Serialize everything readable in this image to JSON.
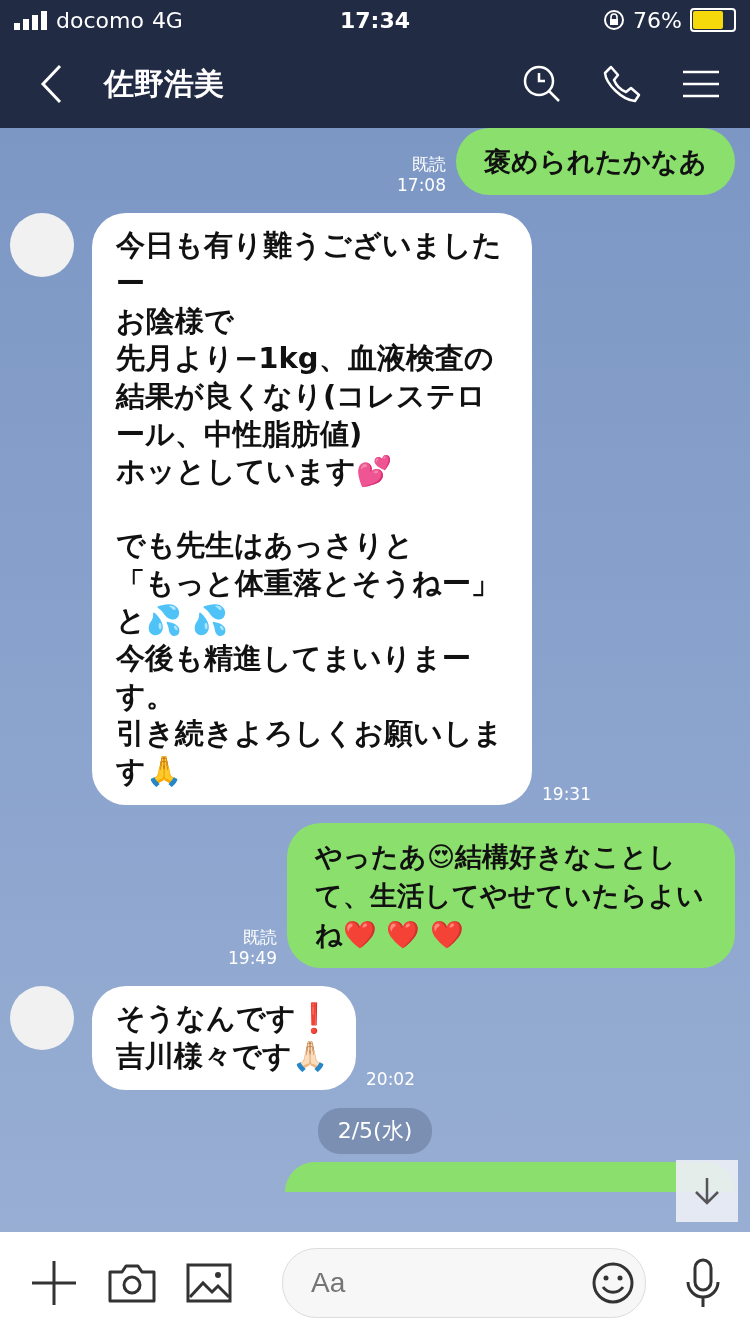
{
  "status_bar": {
    "carrier": "docomo",
    "network": "4G",
    "time": "17:34",
    "battery": "76%"
  },
  "header": {
    "title": "佐野浩美"
  },
  "messages": [
    {
      "kind": "sent",
      "text": "褒められたかなあ",
      "read": "既読",
      "time": "17:08"
    },
    {
      "kind": "received",
      "paragraphs": [
        [
          "今日も有り難うございましたー",
          "お陰様で",
          "先月より−1kg、血液検査の結果が良くなり(コレステロール、中性脂肪値)",
          "ホッとしています💕"
        ],
        [
          "でも先生はあっさりと",
          "「もっと体重落とそうねー」",
          "と💦 💦",
          "今後も精進してまいりまーす。",
          "引き続きよろしくお願いします🙏"
        ]
      ],
      "time": "19:31"
    },
    {
      "kind": "sent",
      "text": "やったあ😍結構好きなことして、生活してやせていたらよいね❤️ ❤️ ❤️",
      "read": "既読",
      "time": "19:49"
    },
    {
      "kind": "received",
      "paragraphs": [
        [
          "そうなんです❗️",
          "吉川様々です🙏🏻"
        ]
      ],
      "time": "20:02"
    },
    {
      "kind": "date",
      "text": "2/5(水)"
    },
    {
      "kind": "sent_partial"
    }
  ],
  "input": {
    "placeholder": "Aa"
  }
}
